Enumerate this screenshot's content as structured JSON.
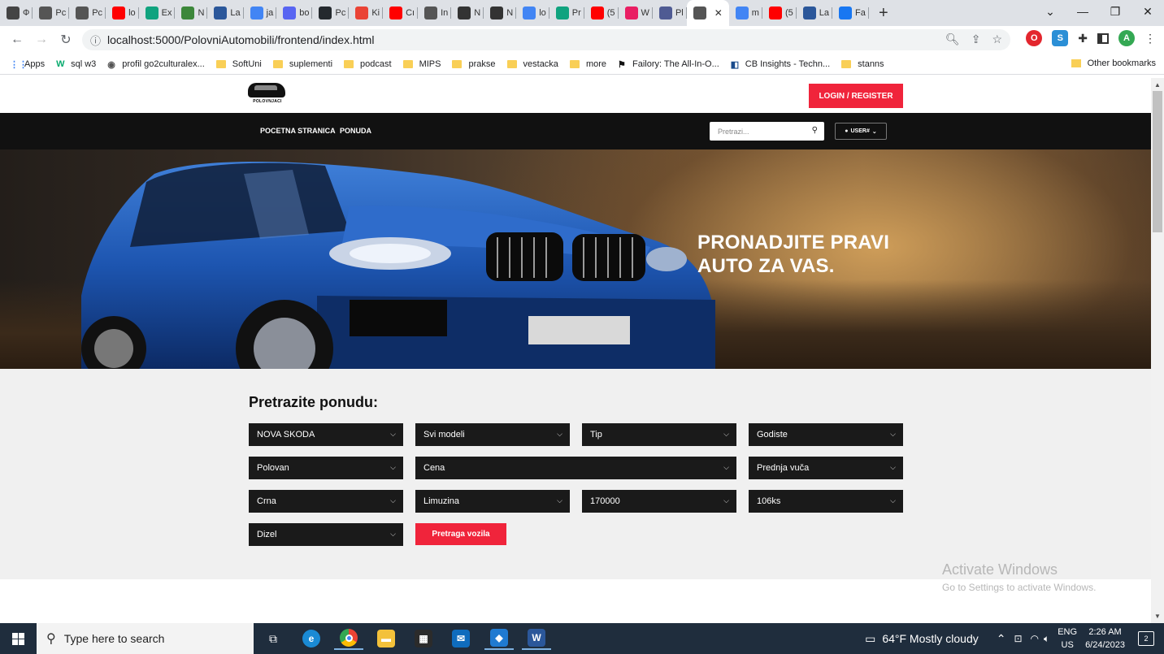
{
  "browser": {
    "tabs": [
      {
        "short": "Ф",
        "color": "#444"
      },
      {
        "short": "Pc",
        "color": "#555"
      },
      {
        "short": "Pc",
        "color": "#555"
      },
      {
        "short": "lo",
        "color": "#ff0000"
      },
      {
        "short": "Ex",
        "color": "#10a37f"
      },
      {
        "short": "N",
        "color": "#3c873a"
      },
      {
        "short": "La",
        "color": "#2b579a"
      },
      {
        "short": "ja",
        "color": "#4285f4"
      },
      {
        "short": "bo",
        "color": "#5865f2"
      },
      {
        "short": "Pc",
        "color": "#24292e"
      },
      {
        "short": "Ki",
        "color": "#ea4335"
      },
      {
        "short": "Cı",
        "color": "#ff0000"
      },
      {
        "short": "In",
        "color": "#555"
      },
      {
        "short": "N",
        "color": "#333"
      },
      {
        "short": "N",
        "color": "#333"
      },
      {
        "short": "lo",
        "color": "#4285f4"
      },
      {
        "short": "Pr",
        "color": "#10a37f"
      },
      {
        "short": "(5",
        "color": "#ff0000"
      },
      {
        "short": "W",
        "color": "#e91e63"
      },
      {
        "short": "Pl",
        "color": "#4f5b93"
      }
    ],
    "active_tab_short": "",
    "tabs_after": [
      {
        "short": "m",
        "color": "#4285f4"
      },
      {
        "short": "(5",
        "color": "#ff0000"
      },
      {
        "short": "La",
        "color": "#2b579a"
      },
      {
        "short": "Fa",
        "color": "#1877f2"
      }
    ],
    "url": "localhost:5000/PolovniAutomobili/frontend/index.html",
    "profile_initial": "A",
    "bookmarks": [
      {
        "label": "Apps",
        "kind": "apps"
      },
      {
        "label": "sql w3",
        "kind": "w3"
      },
      {
        "label": "profil go2culturalex...",
        "kind": "globe"
      },
      {
        "label": "SoftUni",
        "kind": "folder"
      },
      {
        "label": "suplementi",
        "kind": "folder"
      },
      {
        "label": "podcast",
        "kind": "folder"
      },
      {
        "label": "MIPS",
        "kind": "folder"
      },
      {
        "label": "prakse",
        "kind": "folder"
      },
      {
        "label": "vestacka",
        "kind": "folder"
      },
      {
        "label": "more",
        "kind": "folder"
      },
      {
        "label": "Failory: The All-In-O...",
        "kind": "failory"
      },
      {
        "label": "CB Insights - Techn...",
        "kind": "cb"
      },
      {
        "label": "stanns",
        "kind": "folder"
      }
    ],
    "other_bookmarks": "Other bookmarks"
  },
  "site": {
    "logo_text": "POLOVNJACI",
    "login_label": "LOGIN / REGISTER",
    "nav": {
      "home": "POCETNA STRANICA",
      "offer": "PONUDA"
    },
    "search_placeholder": "Pretrazi...",
    "user_label": "USER#"
  },
  "hero": {
    "title_line1": "PRONADJITE PRAVI",
    "title_line2": "AUTO ZA VAS."
  },
  "search": {
    "title": "Pretrazite ponudu:",
    "selects": {
      "brand": "NOVA SKODA",
      "model": "Svi modeli",
      "type": "Tip",
      "year": "Godiste",
      "condition": "Polovan",
      "price": "Cena",
      "drive": "Prednja vuča",
      "color": "Crna",
      "body": "Limuzina",
      "mileage": "170000",
      "power": "106ks",
      "fuel": "Dizel"
    },
    "button": "Pretraga vozila"
  },
  "watermark": {
    "line1": "Activate Windows",
    "line2": "Go to Settings to activate Windows."
  },
  "taskbar": {
    "search_placeholder": "Type here to search",
    "weather": "64°F  Mostly cloudy",
    "lang_top": "ENG",
    "lang_bottom": "US",
    "time": "2:26 AM",
    "date": "6/24/2023",
    "notifications": "2"
  }
}
